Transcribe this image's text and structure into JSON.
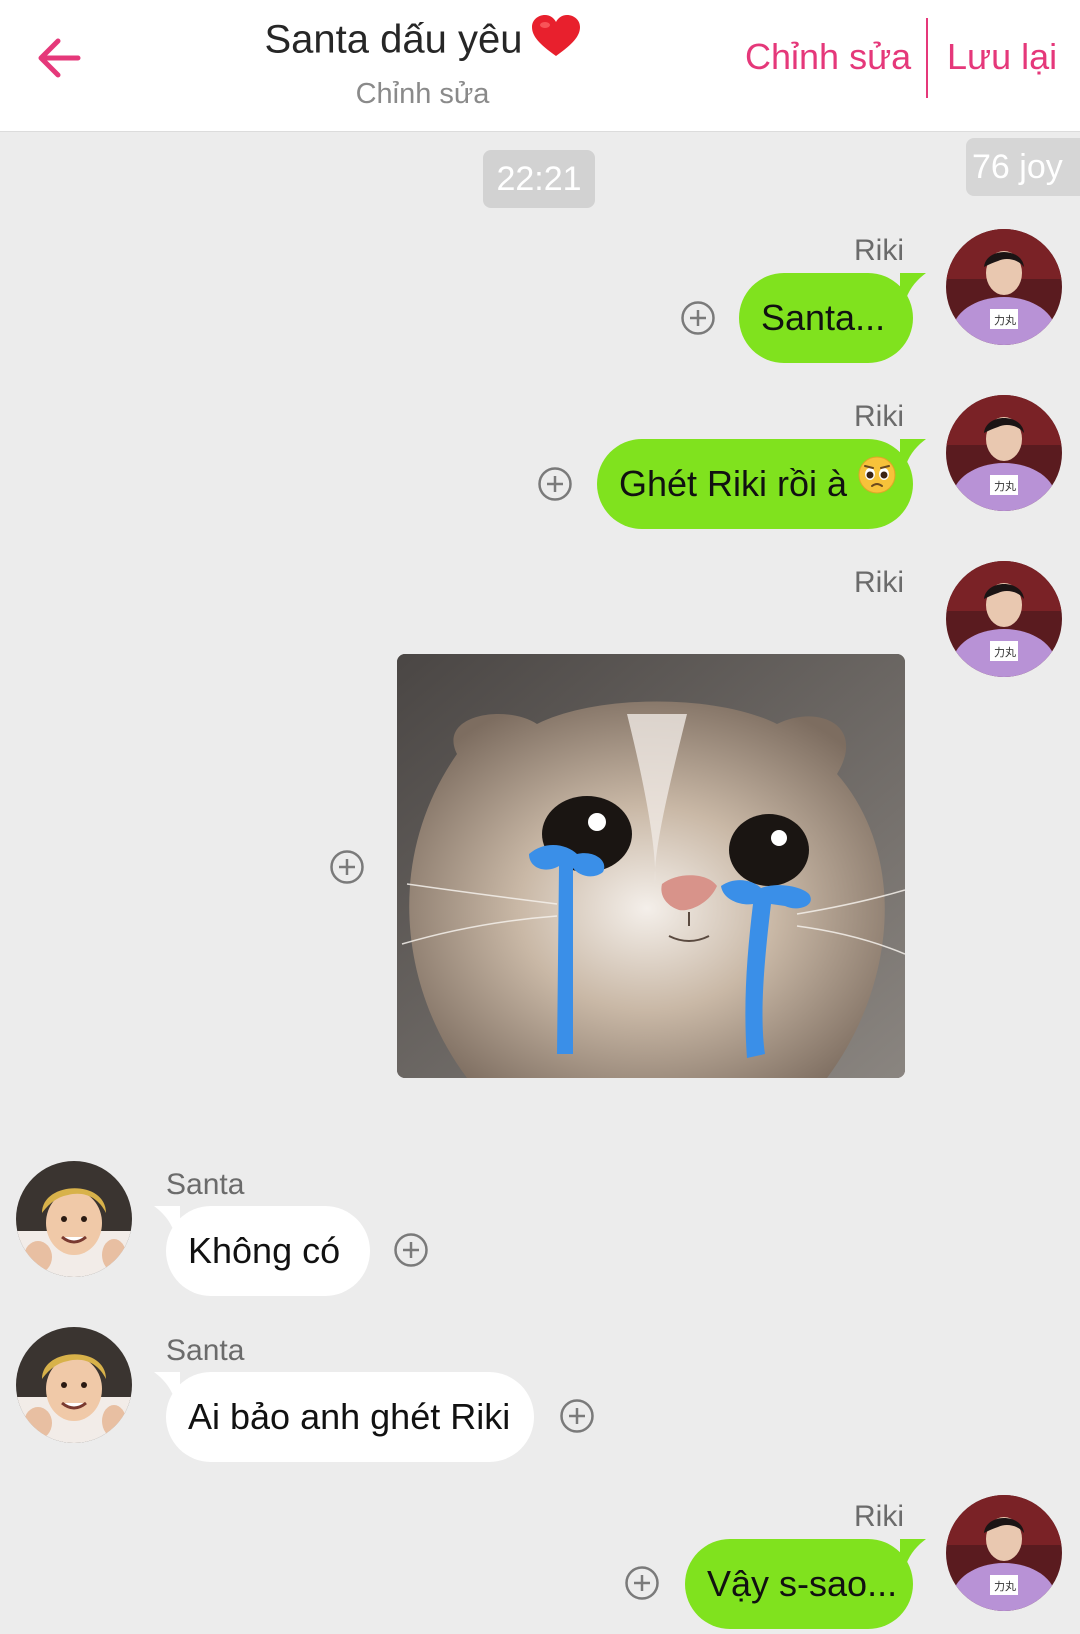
{
  "header": {
    "title": "Santa dấu yêu",
    "subtitle": "Chỉnh sửa",
    "edit_label": "Chỉnh sửa",
    "save_label": "Lưu lại"
  },
  "chat": {
    "timestamp": "22:21",
    "joy_badge": "76 joy",
    "messages": [
      {
        "sender": "Riki",
        "side": "right",
        "text": "Santa..."
      },
      {
        "sender": "Riki",
        "side": "right",
        "text": "Ghét Riki rồi à",
        "emoji": "pleading-face"
      },
      {
        "sender": "Riki",
        "side": "right",
        "type": "image",
        "image": "crying-cat-meme"
      },
      {
        "sender": "Santa",
        "side": "left",
        "text": "Không có"
      },
      {
        "sender": "Santa",
        "side": "left",
        "text": "Ai bảo anh ghét Riki"
      },
      {
        "sender": "Riki",
        "side": "right",
        "text": "Vậy s-sao..."
      }
    ]
  },
  "colors": {
    "accent": "#e5387a",
    "sent_bubble": "#80e21e",
    "received_bubble": "#ffffff",
    "background": "#ececec"
  }
}
